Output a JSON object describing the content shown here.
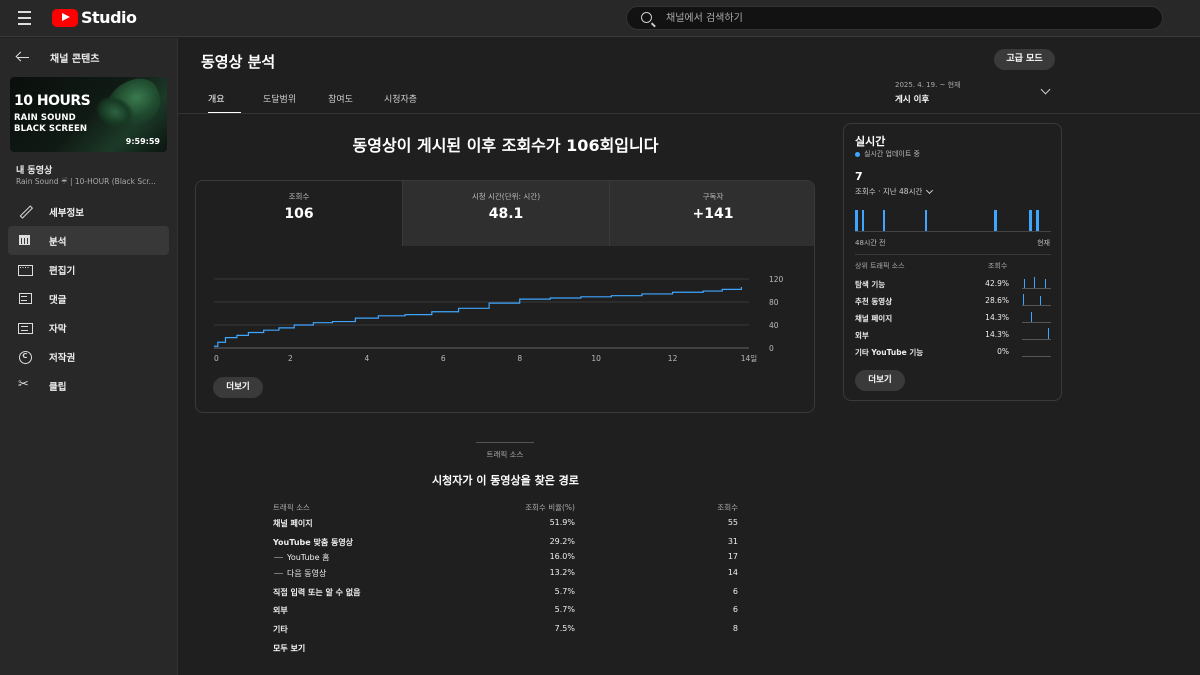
{
  "app": {
    "logo_text": "Studio"
  },
  "search": {
    "placeholder": "채널에서 검색하기"
  },
  "sidebar": {
    "back_label": "채널 콘텐츠",
    "thumbnail": {
      "title": "10 HOURS",
      "line1": "RAIN SOUND",
      "line2": "BLACK SCREEN",
      "duration": "9:59:59"
    },
    "my_video_label": "내 동영상",
    "video_title": "Rain Sound ☔ | 10-HOUR (Black Scr...",
    "items": [
      {
        "label": "세부정보",
        "icon": "pencil-icon",
        "active": false
      },
      {
        "label": "분석",
        "icon": "analytics-icon",
        "active": true
      },
      {
        "label": "편집기",
        "icon": "editor-icon",
        "active": false
      },
      {
        "label": "댓글",
        "icon": "comments-icon",
        "active": false
      },
      {
        "label": "자막",
        "icon": "subtitles-icon",
        "active": false
      },
      {
        "label": "저작권",
        "icon": "copyright-icon",
        "active": false
      },
      {
        "label": "클립",
        "icon": "scissors-icon",
        "active": false
      }
    ]
  },
  "header": {
    "title": "동영상 분석",
    "advanced_mode": "고급 모드",
    "tabs": [
      "개요",
      "도달범위",
      "참여도",
      "시청자층"
    ],
    "date_range_small": "2025. 4. 19. ~ 현재",
    "date_range_big": "게시 이후"
  },
  "overview": {
    "headline": "동영상이 게시된 이후 조회수가 106회입니다",
    "metrics": [
      {
        "label": "조회수",
        "value": "106"
      },
      {
        "label": "시청 시간(단위: 시간)",
        "value": "48.1"
      },
      {
        "label": "구독자",
        "value": "+141"
      }
    ],
    "more_label": "더보기"
  },
  "chart_data": {
    "type": "line",
    "series": [
      {
        "x": [
          0,
          0.1,
          0.3,
          0.6,
          0.9,
          1.3,
          1.7,
          2.1,
          2.6,
          3.1,
          3.7,
          4.3,
          5.0,
          5.7,
          6.4,
          7.2,
          8.0,
          8.8,
          9.6,
          10.4,
          11.2,
          12.0,
          12.8,
          13.3,
          13.8
        ],
        "y": [
          3,
          10,
          18,
          22,
          27,
          31,
          35,
          40,
          44,
          46,
          52,
          56,
          58,
          63,
          69,
          78,
          85,
          87,
          89,
          91,
          94,
          97,
          99,
          102,
          106
        ]
      }
    ],
    "xticks": [
      0,
      2,
      4,
      6,
      8,
      10,
      12
    ],
    "xticklabels": [
      "0",
      "2",
      "4",
      "6",
      "8",
      "10",
      "12",
      "14일"
    ],
    "yticks": [
      0,
      40,
      80,
      120
    ],
    "xlim": [
      0,
      14
    ],
    "ylim": [
      0,
      120
    ],
    "line_color": "#3ea6ff",
    "grid": true
  },
  "realtime": {
    "title": "실시간",
    "live_label": "실시간 업데이트 중",
    "count": "7",
    "sub_label": "조회수 · 지난 48시간",
    "bars": [
      {
        "hour": 0,
        "value": 1
      },
      {
        "hour": 1,
        "value": 1
      },
      {
        "hour": 4,
        "value": 1
      },
      {
        "hour": 10,
        "value": 1
      },
      {
        "hour": 20,
        "value": 1
      },
      {
        "hour": 25,
        "value": 1
      },
      {
        "hour": 26,
        "value": 1
      }
    ],
    "axis_left": "48시간 전",
    "axis_right": "현재",
    "table_header_source": "상위 트래픽 소스",
    "table_header_views": "조회수",
    "rows": [
      {
        "source": "탐색 기능",
        "pct": "42.9%"
      },
      {
        "source": "추천 동영상",
        "pct": "28.6%"
      },
      {
        "source": "채널 페이지",
        "pct": "14.3%"
      },
      {
        "source": "외부",
        "pct": "14.3%"
      },
      {
        "source": "기타 YouTube 기능",
        "pct": "0%"
      }
    ],
    "more_label": "더보기"
  },
  "traffic": {
    "tab_label": "트래픽 소스",
    "title": "시청자가 이 동영상을 찾은 경로",
    "header_source": "트래픽 소스",
    "header_pct": "조회수 비율(%)",
    "header_views": "조회수",
    "rows": [
      {
        "source": "채널 페이지",
        "pct": "51.9%",
        "views": "55",
        "sub": false
      },
      {
        "source": "YouTube 맞춤 동영상",
        "pct": "29.2%",
        "views": "31",
        "sub": false
      },
      {
        "source": "YouTube 홈",
        "pct": "16.0%",
        "views": "17",
        "sub": true
      },
      {
        "source": "다음 동영상",
        "pct": "13.2%",
        "views": "14",
        "sub": true
      },
      {
        "source": "직접 입력 또는 알 수 없음",
        "pct": "5.7%",
        "views": "6",
        "sub": false
      },
      {
        "source": "외부",
        "pct": "5.7%",
        "views": "6",
        "sub": false
      },
      {
        "source": "기타",
        "pct": "7.5%",
        "views": "8",
        "sub": false
      }
    ],
    "see_all": "모두 보기"
  }
}
